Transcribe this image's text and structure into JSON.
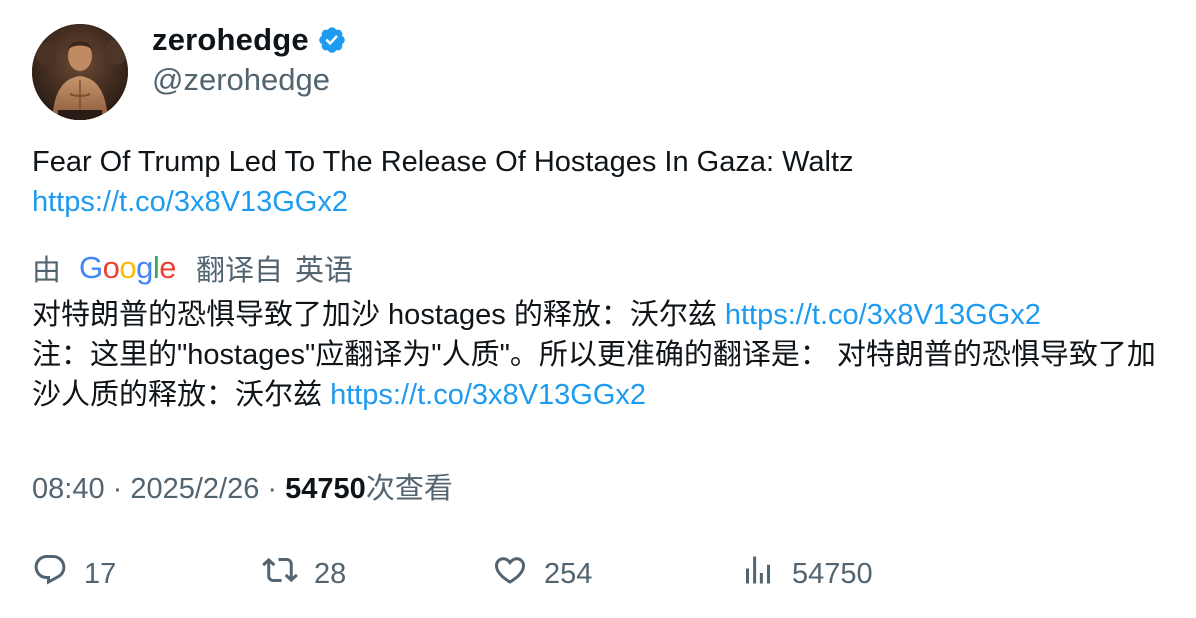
{
  "author": {
    "display_name": "zerohedge",
    "handle": "@zerohedge",
    "verified": true
  },
  "tweet": {
    "text": "Fear Of Trump Led To The Release Of Hostages In Gaza: Waltz",
    "link": "https://t.co/3x8V13GGx2"
  },
  "translation": {
    "by": "由",
    "provider": "Google",
    "from_label": "翻译自",
    "language": "英语",
    "line1_text": "对特朗普的恐惧导致了加沙 hostages 的释放：沃尔兹 ",
    "line1_link": "https://t.co/3x8V13GGx2",
    "note_text": "注：这里的\"hostages\"应翻译为\"人质\"。所以更准确的翻译是： 对特朗普的恐惧导致了加沙人质的释放：沃尔兹 ",
    "note_link": "https://t.co/3x8V13GGx2"
  },
  "meta": {
    "time": "08:40",
    "separator": " · ",
    "date": "2025/2/26",
    "views_count": "54750",
    "views_label": "次查看"
  },
  "actions": {
    "replies": "17",
    "retweets": "28",
    "likes": "254",
    "views": "54750"
  },
  "colors": {
    "link": "#1d9bf0",
    "secondary_text": "#536471",
    "primary_text": "#0f1419",
    "verified_badge": "#1d9bf0"
  }
}
